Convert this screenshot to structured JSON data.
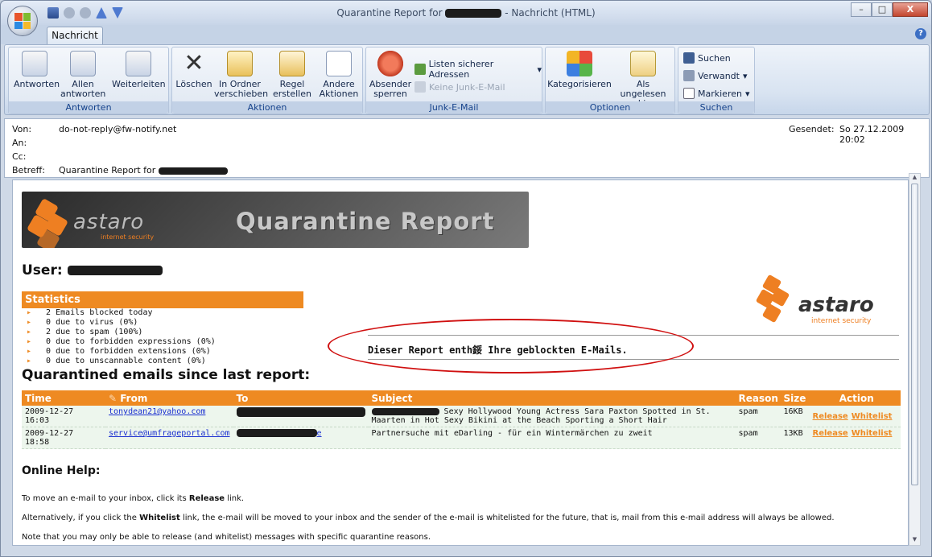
{
  "window": {
    "title_prefix": "Quarantine Report for ",
    "title_suffix": " - Nachricht (HTML)",
    "controls": [
      "–",
      "□",
      "X"
    ]
  },
  "tabs": [
    {
      "label": "Nachricht",
      "active": true
    }
  ],
  "ribbon": {
    "groups": [
      {
        "label": "Antworten",
        "buttons": [
          "Antworten",
          "Allen antworten",
          "Weiterleiten"
        ]
      },
      {
        "label": "Aktionen",
        "buttons": [
          "Löschen",
          "In Ordner verschieben",
          "Regel erstellen",
          "Andere Aktionen"
        ]
      },
      {
        "label": "Junk-E-Mail",
        "buttons": [
          "Absender sperren",
          "Listen sicherer Adressen",
          "Keine Junk-E-Mail"
        ]
      },
      {
        "label": "Optionen",
        "buttons": [
          "Kategorisieren",
          "Als ungelesen markieren"
        ]
      },
      {
        "label": "Suchen",
        "buttons": [
          "Suchen",
          "Verwandt",
          "Markieren"
        ]
      }
    ]
  },
  "header": {
    "from_label": "Von:",
    "from_value": "do-not-reply@fw-notify.net",
    "to_label": "An:",
    "cc_label": "Cc:",
    "subject_label": "Betreff:",
    "subject_value": "Quarantine Report for",
    "sent_label": "Gesendet:",
    "sent_value": "So 27.12.2009 20:02"
  },
  "report": {
    "banner_brand": "astaro",
    "banner_tagline": "internet security",
    "banner_title": "Quarantine Report",
    "user_label": "User:",
    "stats_title": "Statistics",
    "stats": [
      "2 Emails blocked today",
      "0 due to virus (0%)",
      "2 due to spam (100%)",
      "0 due to forbidden expressions (0%)",
      "0 due to forbidden extensions (0%)",
      "0 due to unscannable content (0%)"
    ],
    "notice": "Dieser Report enth鋖 Ihre geblockten E-Mails.",
    "quarantine_title": "Quarantined emails since last report:",
    "columns": [
      "Time",
      "From",
      "To",
      "Subject",
      "Reason",
      "Size",
      "Action"
    ],
    "rows": [
      {
        "time": "2009-12-27 16:03",
        "from": "tonydean21@yahoo.com",
        "subject": "Sexy Hollywood Young Actress Sara Paxton Spotted in St. Maarten in Hot Sexy Bikini at the Beach Sporting a Short Hair",
        "reason": "spam",
        "size": "16KB",
        "release": "Release",
        "whitelist": "Whitelist"
      },
      {
        "time": "2009-12-27 18:58",
        "from": "service@umfrageportal.com",
        "to_suffix": "e",
        "subject": "Partnersuche mit eDarling - für ein Wintermärchen zu zweit",
        "reason": "spam",
        "size": "13KB",
        "release": "Release",
        "whitelist": "Whitelist"
      }
    ],
    "help_title": "Online Help:",
    "help_1a": "To move an e-mail to your inbox, click its ",
    "help_1b": "Release",
    "help_1c": " link.",
    "help_2a": "Alternatively, if you click the ",
    "help_2b": "Whitelist",
    "help_2c": " link, the e-mail will be moved to your inbox and the sender of the e-mail is whitelisted for the future, that is, mail from this e-mail address will always be allowed.",
    "help_3": "Note that you may only be able to release (and whitelist) messages with specific quarantine reasons."
  }
}
